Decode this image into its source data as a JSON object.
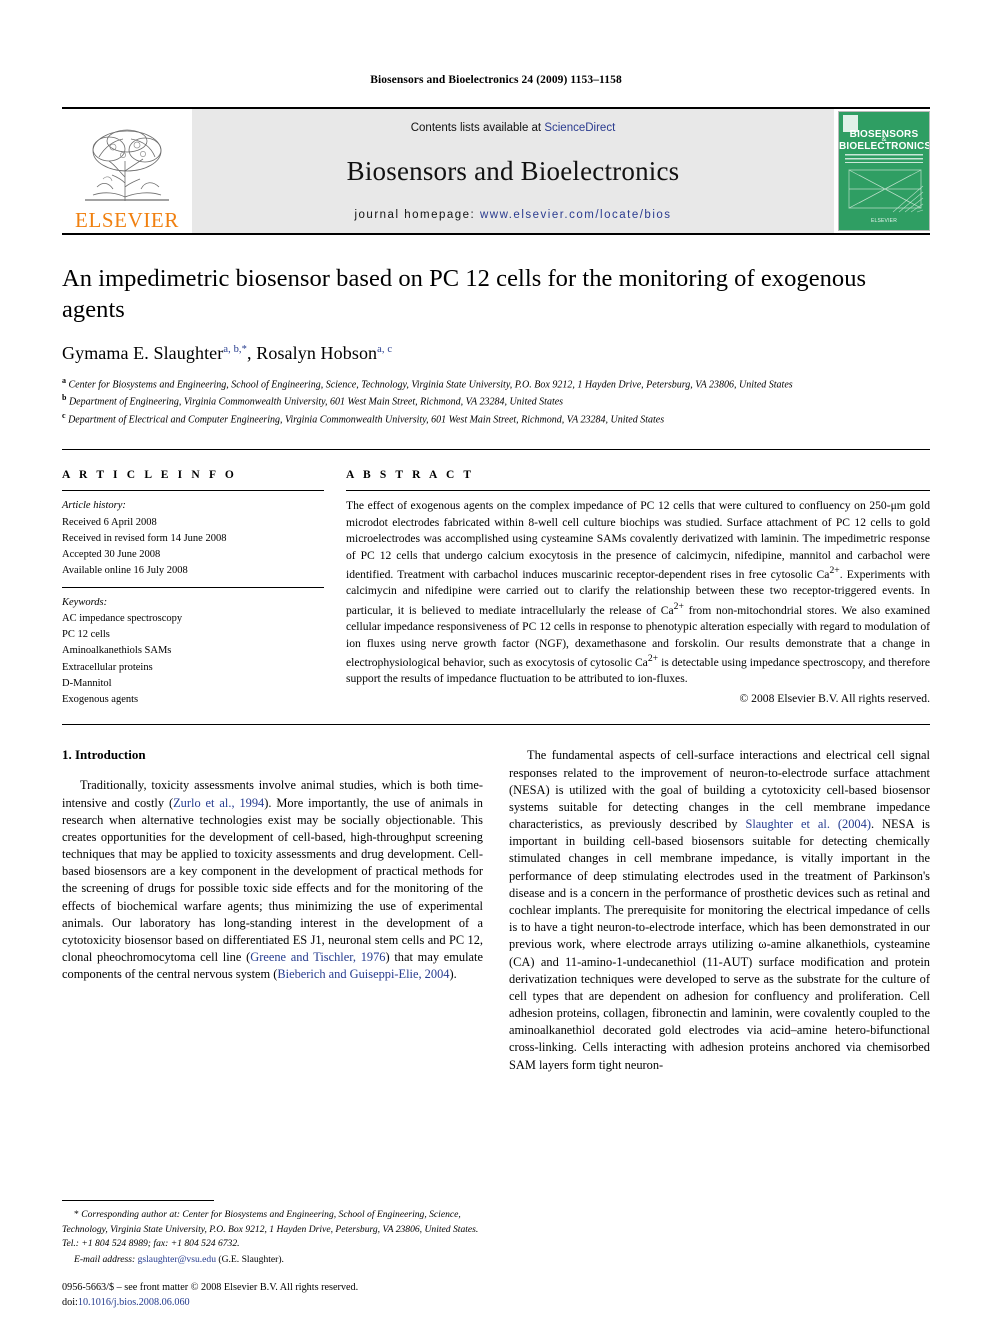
{
  "running_head": "Biosensors and Bioelectronics 24 (2009) 1153–1158",
  "masthead": {
    "publisher_wordmark": "ELSEVIER",
    "contents_prefix": "Contents lists available at ",
    "contents_link": "ScienceDirect",
    "journal_title": "Biosensors and Bioelectronics",
    "homepage_prefix": "journal homepage: ",
    "homepage_url": "www.elsevier.com/locate/bios",
    "cover": {
      "line1": "BIOSENSORS",
      "line2": "BIOELECTRONICS",
      "amp": "&",
      "footer": "ELSEVIER",
      "bg_color": "#2f9e63"
    }
  },
  "article": {
    "title": "An impedimetric biosensor based on PC 12 cells for the monitoring of exogenous agents",
    "authors": [
      {
        "name": "Gymama E. Slaughter",
        "marks": "a, b,"
      },
      {
        "name": "Rosalyn Hobson",
        "marks": "a, c"
      }
    ],
    "author_line_sep": ", ",
    "corresponding_mark": "*",
    "affiliations": [
      {
        "mark": "a",
        "text": "Center for Biosystems and Engineering, School of Engineering, Science, Technology, Virginia State University, P.O. Box 9212, 1 Hayden Drive, Petersburg, VA 23806, United States"
      },
      {
        "mark": "b",
        "text": "Department of Engineering, Virginia Commonwealth University, 601 West Main Street, Richmond, VA 23284, United States"
      },
      {
        "mark": "c",
        "text": "Department of Electrical and Computer Engineering, Virginia Commonwealth University, 601 West Main Street, Richmond, VA 23284, United States"
      }
    ]
  },
  "article_info": {
    "heading": "A R T I C L E   I N F O",
    "history_label": "Article history:",
    "history": [
      "Received 6 April 2008",
      "Received in revised form 14 June 2008",
      "Accepted 30 June 2008",
      "Available online 16 July 2008"
    ],
    "keywords_label": "Keywords:",
    "keywords": [
      "AC impedance spectroscopy",
      "PC 12 cells",
      "Aminoalkanethiols SAMs",
      "Extracellular proteins",
      "D-Mannitol",
      "Exogenous agents"
    ]
  },
  "abstract": {
    "heading": "A B S T R A C T",
    "text": "The effect of exogenous agents on the complex impedance of PC 12 cells that were cultured to confluency on 250-μm gold microdot electrodes fabricated within 8-well cell culture biochips was studied. Surface attachment of PC 12 cells to gold microelectrodes was accomplished using cysteamine SAMs covalently derivatized with laminin. The impedimetric response of PC 12 cells that undergo calcium exocytosis in the presence of calcimycin, nifedipine, mannitol and carbachol were identified. Treatment with carbachol induces muscarinic receptor-dependent rises in free cytosolic Ca2+. Experiments with calcimycin and nifedipine were carried out to clarify the relationship between these two receptor-triggered events. In particular, it is believed to mediate intracellularly the release of Ca2+ from non-mitochondrial stores. We also examined cellular impedance responsiveness of PC 12 cells in response to phenotypic alteration especially with regard to modulation of ion fluxes using nerve growth factor (NGF), dexamethasone and forskolin. Our results demonstrate that a change in electrophysiological behavior, such as exocytosis of cytosolic Ca2+ is detectable using impedance spectroscopy, and therefore support the results of impedance fluctuation to be attributed to ion-fluxes.",
    "copyright": "© 2008 Elsevier B.V. All rights reserved."
  },
  "body": {
    "section_number_title": "1.  Introduction",
    "left_paragraph_parts": [
      "Traditionally, toxicity assessments involve animal studies, which is both time-intensive and costly (",
      "Zurlo et al., 1994",
      "). More importantly, the use of animals in research when alternative technologies exist may be socially objectionable. This creates opportunities for the development of cell-based, high-throughput screening techniques that may be applied to toxicity assessments and drug development. Cell-based biosensors are a key component in the development of practical methods for the screening of drugs for possible toxic side effects and for the monitoring of the effects of biochemical warfare agents; thus minimizing the use of experimental animals. Our laboratory has long-standing interest in the development of a cytotoxicity biosensor based on differentiated ES J1, neuronal stem cells and PC 12, clonal pheochromocytoma cell line (",
      "Greene and Tischler, 1976",
      ") that may emulate components of the central nervous system (",
      "Bieberich and Guiseppi-Elie, 2004",
      ")."
    ],
    "right_paragraph_parts": [
      "The fundamental aspects of cell-surface interactions and electrical cell signal responses related to the improvement of neuron-to-electrode surface attachment (NESA) is utilized with the goal of building a cytotoxicity cell-based biosensor systems suitable for detecting changes in the cell membrane impedance characteristics, as previously described by ",
      "Slaughter et al. (2004)",
      ". NESA is important in building cell-based biosensors suitable for detecting chemically stimulated changes in cell membrane impedance, is vitally important in the performance of deep stimulating electrodes used in the treatment of Parkinson's disease and is a concern in the performance of prosthetic devices such as retinal and cochlear implants. The prerequisite for monitoring the electrical impedance of cells is to have a tight neuron-to-electrode interface, which has been demonstrated in our previous work, where electrode arrays utilizing ω-amine alkanethiols, cysteamine (CA) and 11-amino-1-undecanethiol (11-AUT) surface modification and protein derivatization techniques were developed to serve as the substrate for the culture of cell types that are dependent on adhesion for confluency and proliferation. Cell adhesion proteins, collagen, fibronectin and laminin, were covalently coupled to the aminoalkanethiol decorated gold electrodes via acid–amine hetero-bifunctional cross-linking. Cells interacting with adhesion proteins anchored via chemisorbed SAM layers form tight neuron-"
    ]
  },
  "footnotes": {
    "corresponding_mark": "*",
    "corresponding_text_italic": "Corresponding author at: Center for Biosystems and Engineering, School of Engineering, Science, Technology, Virginia State University, P.O. Box 9212, 1 Hayden Drive, Petersburg, VA 23806, United States. Tel.: +1 804 524 8989; fax: +1 804 524 6732.",
    "email_label": "E-mail address:",
    "email_address": "gslaughter@vsu.edu",
    "email_owner": "(G.E. Slaughter)."
  },
  "footer": {
    "issn_line": "0956-5663/$ – see front matter © 2008 Elsevier B.V. All rights reserved.",
    "doi_label": "doi:",
    "doi_value": "10.1016/j.bios.2008.06.060"
  }
}
